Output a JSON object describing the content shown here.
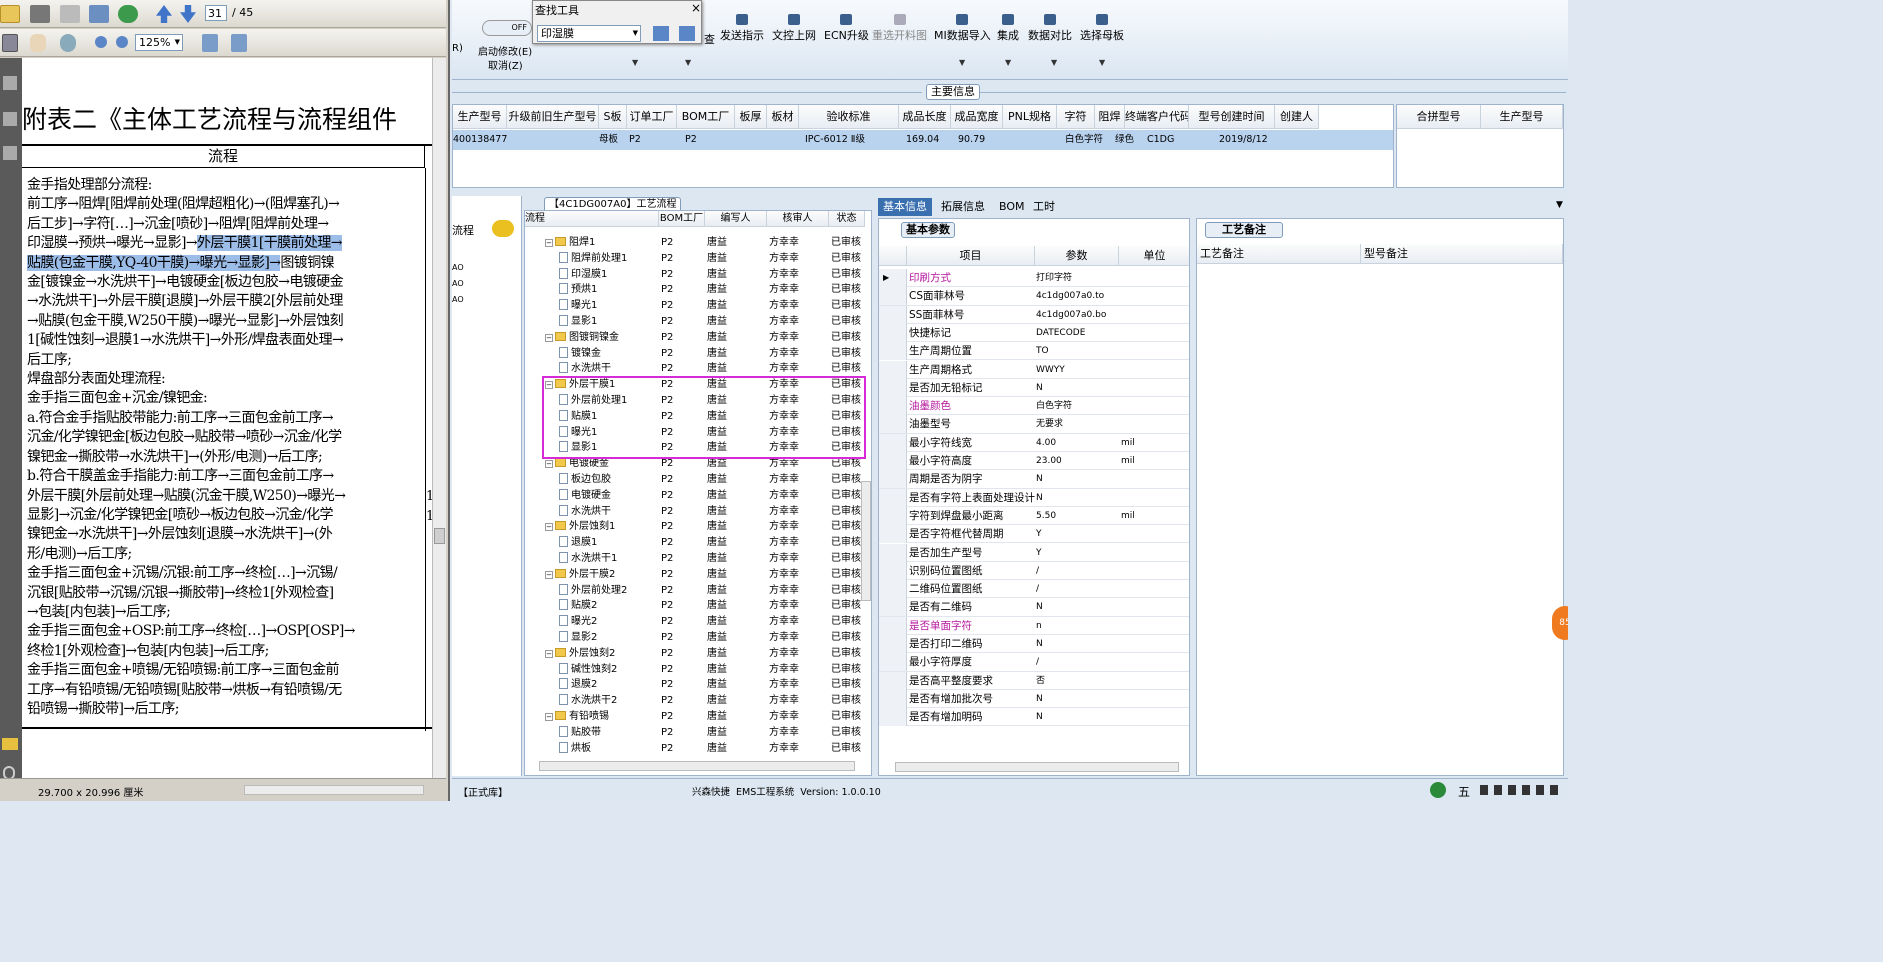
{
  "pdf": {
    "page_current": "31",
    "page_total": "/ 45",
    "zoom": "125%",
    "heading": "附表二《主体工艺流程与流程组件",
    "col_header": "流程",
    "lines": [
      {
        "t": "金手指处理部分流程:"
      },
      {
        "t": "前工序→阻焊[阻焊前处理(阻焊超粗化)→(阻焊塞孔)→"
      },
      {
        "t": "后工步]→字符[…]→沉金[喷砂]→阻焊[阻焊前处理→"
      },
      {
        "t": "印湿膜→预烘→曝光→显影]→",
        "h": "外层干膜1[干膜前处理→"
      },
      {
        "h": "贴膜(包金干膜,YQ-40干膜)→曝光→显影]→",
        "t2": "图镀铜镍"
      },
      {
        "t": "金[镀镍金→水洗烘干]→电镀硬金[板边包胶→电镀硬金"
      },
      {
        "t": "→水洗烘干]→外层干膜[退膜]→外层干膜2[外层前处理"
      },
      {
        "t": "→贴膜(包金干膜,W250干膜)→曝光→显影]→外层蚀刻"
      },
      {
        "t": "1[碱性蚀刻→退膜1→水洗烘干]→外形/焊盘表面处理→"
      },
      {
        "t": "后工序;"
      },
      {
        "t": "焊盘部分表面处理流程:"
      },
      {
        "t": "金手指三面包金+沉金/镍钯金:"
      },
      {
        "t": "a.符合金手指贴胶带能力:前工序→三面包金前工序→"
      },
      {
        "t": "沉金/化学镍钯金[板边包胶→贴胶带→喷砂→沉金/化学"
      },
      {
        "t": "镍钯金→撕胶带→水洗烘干]→(外形/电测)→后工序;"
      },
      {
        "t": "b.符合干膜盖金手指能力:前工序→三面包金前工序→"
      },
      {
        "t": "外层干膜[外层前处理→贴膜(沉金干膜,W250)→曝光→"
      },
      {
        "t": "显影]→沉金/化学镍钯金[喷砂→板边包胶→沉金/化学"
      },
      {
        "t": "镍钯金→水洗烘干]→外层蚀刻[退膜→水洗烘干]→(外"
      },
      {
        "t": "形/电测)→后工序;"
      },
      {
        "t": "金手指三面包金+沉锡/沉银:前工序→终检[…]→沉锡/"
      },
      {
        "t": "沉银[贴胶带→沉锡/沉银→撕胶带]→终检1[外观检查]"
      },
      {
        "t": "→包装[内包装]→后工序;"
      },
      {
        "t": "金手指三面包金+OSP:前工序→终检[…]→OSP[OSP]→"
      },
      {
        "t": "终检1[外观检查]→包装[内包装]→后工序;"
      },
      {
        "t": "金手指三面包金+喷锡/无铅喷锡:前工序→三面包金前"
      },
      {
        "t": "工序→有铅喷锡/无铅喷锡[贴胶带→烘板→有铅喷锡/无"
      },
      {
        "t": "铅喷锡→撕胶带]→后工序;"
      }
    ],
    "right_marks": [
      "1",
      "1"
    ],
    "status": "29.700 x 20.996 厘米"
  },
  "find": {
    "title": "查找工具",
    "value": "印湿膜",
    "close": "×"
  },
  "ribbon": {
    "toggle": "OFF",
    "left_label1": "R)",
    "left_label2": "启动修改(E)",
    "left_label3": "取消(Z)",
    "left_partial": "查",
    "buttons": [
      {
        "label": "发送指示",
        "icon": "upload-icon"
      },
      {
        "label": "文控上网",
        "icon": "cloud-upload-icon"
      },
      {
        "label": "ECN升级",
        "icon": "upgrade-icon"
      },
      {
        "label": "重选开料图",
        "icon": "image-icon",
        "disabled": true
      },
      {
        "label": "MI数据导入",
        "icon": "import-icon"
      },
      {
        "label": "集成",
        "icon": "download-icon"
      },
      {
        "label": "数据对比",
        "icon": "compare-icon"
      },
      {
        "label": "选择母板",
        "icon": "shuffle-icon"
      }
    ]
  },
  "main_title": "主要信息",
  "grid1": {
    "headers": [
      "生产型号",
      "升级前旧生产型号",
      "S板",
      "订单工厂",
      "BOM工厂",
      "板厚",
      "板材",
      "验收标准",
      "成品长度",
      "成品宽度",
      "PNL规格",
      "字符",
      "阻焊",
      "终端客户代码",
      "型号创建时间",
      "创建人"
    ],
    "row": {
      "model": "400138477",
      "s": "母板",
      "order_factory": "P2",
      "bom_factory": "P2",
      "standard": "IPC-6012 Ⅱ级",
      "length": "169.04",
      "width": "90.79",
      "char": "白色字符",
      "mask": "绿色",
      "customer": "C1DG",
      "created": "2019/8/12"
    }
  },
  "grid2": {
    "headers": [
      "合拼型号",
      "生产型号"
    ]
  },
  "left": {
    "label": "流程",
    "items": [
      "AO",
      "AO",
      "AO"
    ]
  },
  "tree": {
    "title": "【4C1DG007A0】工艺流程",
    "headers": [
      "流程",
      "BOM工厂",
      "编写人",
      "核审人",
      "状态"
    ],
    "rows": [
      {
        "level": 0,
        "name": "阻焊1",
        "f": "P2",
        "w": "唐益",
        "r": "方幸幸",
        "s": "已审核"
      },
      {
        "level": 1,
        "name": "阻焊前处理1",
        "f": "P2",
        "w": "唐益",
        "r": "方幸幸",
        "s": "已审核"
      },
      {
        "level": 1,
        "name": "印湿膜1",
        "f": "P2",
        "w": "唐益",
        "r": "方幸幸",
        "s": "已审核"
      },
      {
        "level": 1,
        "name": "预烘1",
        "f": "P2",
        "w": "唐益",
        "r": "方幸幸",
        "s": "已审核"
      },
      {
        "level": 1,
        "name": "曝光1",
        "f": "P2",
        "w": "唐益",
        "r": "方幸幸",
        "s": "已审核"
      },
      {
        "level": 1,
        "name": "显影1",
        "f": "P2",
        "w": "唐益",
        "r": "方幸幸",
        "s": "已审核"
      },
      {
        "level": 0,
        "name": "图镀铜镍金",
        "f": "P2",
        "w": "唐益",
        "r": "方幸幸",
        "s": "已审核"
      },
      {
        "level": 1,
        "name": "镀镍金",
        "f": "P2",
        "w": "唐益",
        "r": "方幸幸",
        "s": "已审核"
      },
      {
        "level": 1,
        "name": "水洗烘干",
        "f": "P2",
        "w": "唐益",
        "r": "方幸幸",
        "s": "已审核"
      },
      {
        "level": 0,
        "name": "外层干膜1",
        "f": "P2",
        "w": "唐益",
        "r": "方幸幸",
        "s": "已审核"
      },
      {
        "level": 1,
        "name": "外层前处理1",
        "f": "P2",
        "w": "唐益",
        "r": "方幸幸",
        "s": "已审核"
      },
      {
        "level": 1,
        "name": "贴膜1",
        "f": "P2",
        "w": "唐益",
        "r": "方幸幸",
        "s": "已审核"
      },
      {
        "level": 1,
        "name": "曝光1",
        "f": "P2",
        "w": "唐益",
        "r": "方幸幸",
        "s": "已审核"
      },
      {
        "level": 1,
        "name": "显影1",
        "f": "P2",
        "w": "唐益",
        "r": "方幸幸",
        "s": "已审核"
      },
      {
        "level": 0,
        "name": "电镀硬金",
        "f": "P2",
        "w": "唐益",
        "r": "方幸幸",
        "s": "已审核"
      },
      {
        "level": 1,
        "name": "板边包胶",
        "f": "P2",
        "w": "唐益",
        "r": "方幸幸",
        "s": "已审核"
      },
      {
        "level": 1,
        "name": "电镀硬金",
        "f": "P2",
        "w": "唐益",
        "r": "方幸幸",
        "s": "已审核"
      },
      {
        "level": 1,
        "name": "水洗烘干",
        "f": "P2",
        "w": "唐益",
        "r": "方幸幸",
        "s": "已审核"
      },
      {
        "level": 0,
        "name": "外层蚀刻1",
        "f": "P2",
        "w": "唐益",
        "r": "方幸幸",
        "s": "已审核"
      },
      {
        "level": 1,
        "name": "退膜1",
        "f": "P2",
        "w": "唐益",
        "r": "方幸幸",
        "s": "已审核"
      },
      {
        "level": 1,
        "name": "水洗烘干1",
        "f": "P2",
        "w": "唐益",
        "r": "方幸幸",
        "s": "已审核"
      },
      {
        "level": 0,
        "name": "外层干膜2",
        "f": "P2",
        "w": "唐益",
        "r": "方幸幸",
        "s": "已审核"
      },
      {
        "level": 1,
        "name": "外层前处理2",
        "f": "P2",
        "w": "唐益",
        "r": "方幸幸",
        "s": "已审核"
      },
      {
        "level": 1,
        "name": "贴膜2",
        "f": "P2",
        "w": "唐益",
        "r": "方幸幸",
        "s": "已审核"
      },
      {
        "level": 1,
        "name": "曝光2",
        "f": "P2",
        "w": "唐益",
        "r": "方幸幸",
        "s": "已审核"
      },
      {
        "level": 1,
        "name": "显影2",
        "f": "P2",
        "w": "唐益",
        "r": "方幸幸",
        "s": "已审核"
      },
      {
        "level": 0,
        "name": "外层蚀刻2",
        "f": "P2",
        "w": "唐益",
        "r": "方幸幸",
        "s": "已审核"
      },
      {
        "level": 1,
        "name": "碱性蚀刻2",
        "f": "P2",
        "w": "唐益",
        "r": "方幸幸",
        "s": "已审核"
      },
      {
        "level": 1,
        "name": "退膜2",
        "f": "P2",
        "w": "唐益",
        "r": "方幸幸",
        "s": "已审核"
      },
      {
        "level": 1,
        "name": "水洗烘干2",
        "f": "P2",
        "w": "唐益",
        "r": "方幸幸",
        "s": "已审核"
      },
      {
        "level": 0,
        "name": "有铅喷锡",
        "f": "P2",
        "w": "唐益",
        "r": "方幸幸",
        "s": "已审核"
      },
      {
        "level": 1,
        "name": "贴胶带",
        "f": "P2",
        "w": "唐益",
        "r": "方幸幸",
        "s": "已审核"
      },
      {
        "level": 1,
        "name": "烘板",
        "f": "P2",
        "w": "唐益",
        "r": "方幸幸",
        "s": "已审核"
      }
    ]
  },
  "tabs": [
    "基本信息",
    "拓展信息",
    "BOM",
    "工时"
  ],
  "basic": {
    "title": "基本参数",
    "headers": [
      "项目",
      "参数",
      "单位"
    ],
    "rows": [
      {
        "k": "印刷方式",
        "v": "打印字符",
        "u": "",
        "m": true
      },
      {
        "k": "CS面菲林号",
        "v": "4c1dg007a0.to",
        "u": ""
      },
      {
        "k": "SS面菲林号",
        "v": "4c1dg007a0.bo",
        "u": ""
      },
      {
        "k": "快捷标记",
        "v": "DATECODE",
        "u": ""
      },
      {
        "k": "生产周期位置",
        "v": "TO",
        "u": ""
      },
      {
        "k": "生产周期格式",
        "v": "WWYY",
        "u": ""
      },
      {
        "k": "是否加无铅标记",
        "v": "N",
        "u": ""
      },
      {
        "k": "油墨颜色",
        "v": "白色字符",
        "u": "",
        "m": true
      },
      {
        "k": "油墨型号",
        "v": "无要求",
        "u": ""
      },
      {
        "k": "最小字符线宽",
        "v": "4.00",
        "u": "mil"
      },
      {
        "k": "最小字符高度",
        "v": "23.00",
        "u": "mil"
      },
      {
        "k": "周期是否为阴字",
        "v": "N",
        "u": ""
      },
      {
        "k": "是否有字符上表面处理设计",
        "v": "N",
        "u": ""
      },
      {
        "k": "字符到焊盘最小距离",
        "v": "5.50",
        "u": "mil"
      },
      {
        "k": "是否字符框代替周期",
        "v": "Y",
        "u": ""
      },
      {
        "k": "是否加生产型号",
        "v": "Y",
        "u": ""
      },
      {
        "k": "识别码位置图纸",
        "v": "/",
        "u": ""
      },
      {
        "k": "二维码位置图纸",
        "v": "/",
        "u": ""
      },
      {
        "k": "是否有二维码",
        "v": "N",
        "u": ""
      },
      {
        "k": "是否单面字符",
        "v": "n",
        "u": "",
        "m": true
      },
      {
        "k": "是否打印二维码",
        "v": "N",
        "u": ""
      },
      {
        "k": "最小字符厚度",
        "v": "/",
        "u": ""
      },
      {
        "k": "是否高平整度要求",
        "v": "否",
        "u": ""
      },
      {
        "k": "是否有增加批次号",
        "v": "N",
        "u": ""
      },
      {
        "k": "是否有增加明码",
        "v": "N",
        "u": ""
      }
    ]
  },
  "note": {
    "title": "工艺备注",
    "col1": "工艺备注",
    "col2": "型号备注"
  },
  "status": {
    "left": "【正式库】",
    "center": "兴森快捷  EMS工程系统  Version: 1.0.0.10",
    "ime": "五",
    "badge": "85"
  }
}
